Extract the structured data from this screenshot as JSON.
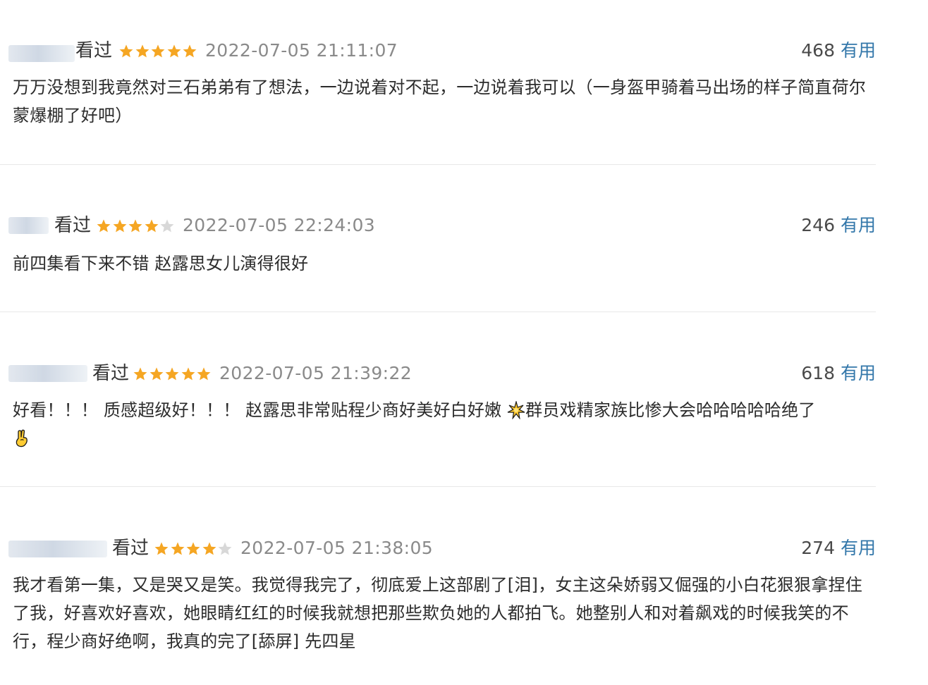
{
  "reviews": [
    {
      "status": "看过",
      "rating": 5,
      "time": "2022-07-05 21:11:07",
      "votes": "468",
      "useful_label": "有用",
      "content": "万万没想到我竟然对三石弟弟有了想法，一边说着对不起，一边说着我可以（一身盔甲骑着马出场的样子简直荷尔蒙爆棚了好吧）"
    },
    {
      "status": "看过",
      "rating": 4,
      "time": "2022-07-05 22:24:03",
      "votes": "246",
      "useful_label": "有用",
      "content": "前四集看下来不错 赵露思女儿演得很好"
    },
    {
      "status": "看过",
      "rating": 5,
      "time": "2022-07-05 21:39:22",
      "votes": "618",
      "useful_label": "有用",
      "content_a": "好看！！！ 质感超级好！！！ 赵露思非常贴程少商好美好白好嫩",
      "content_b": "群员戏精家族比惨大会哈哈哈哈哈绝了",
      "emoji_1": "sparkle-emoji",
      "emoji_2": "hand-gesture-emoji"
    },
    {
      "status": "看过",
      "rating": 4,
      "time": "2022-07-05 21:38:05",
      "votes": "274",
      "useful_label": "有用",
      "content": "我才看第一集，又是哭又是笑。我觉得我完了，彻底爱上这部剧了[泪]，女主这朵娇弱又倔强的小白花狠狠拿捏住了我，好喜欢好喜欢，她眼睛红红的时候我就想把那些欺负她的人都拍飞。她整别人和对着飙戏的时候我笑的不行，程少商好绝啊，我真的完了[舔屏] 先四星"
    }
  ],
  "colors": {
    "star_filled": "#f5a623",
    "star_empty": "#d8d8d8",
    "useful_link": "#3377aa",
    "time_text": "#8a8a8a"
  }
}
